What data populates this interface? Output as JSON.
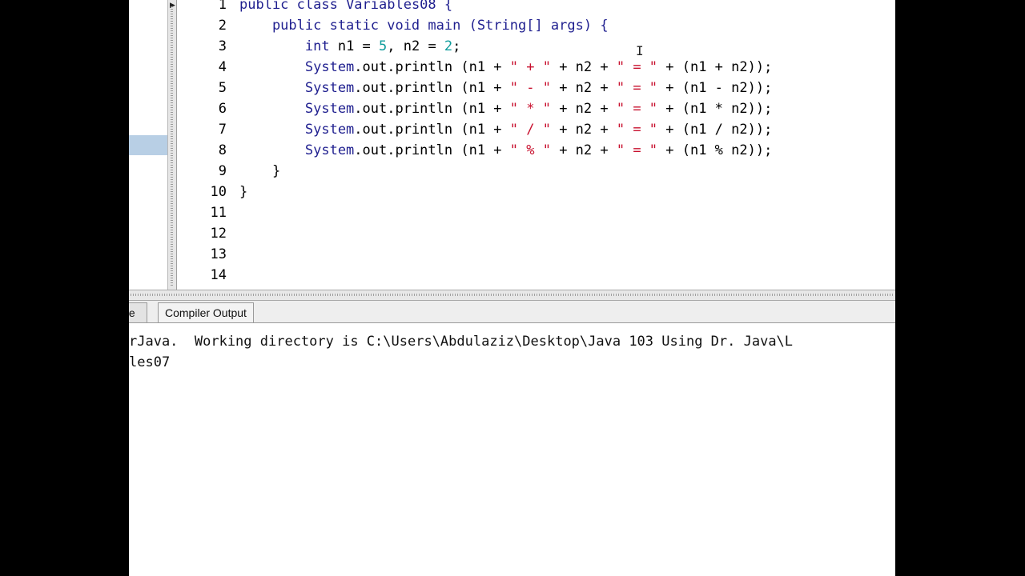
{
  "editor": {
    "lines": [
      {
        "n": "1",
        "segs": [
          {
            "t": "public class ",
            "c": "kw"
          },
          {
            "t": "Variables08",
            "c": "ty"
          },
          {
            "t": " {",
            "c": "kw"
          }
        ]
      },
      {
        "n": "2",
        "segs": [
          {
            "t": "    public static void ",
            "c": "kw"
          },
          {
            "t": "main (String[] args) {",
            "c": "ty"
          }
        ]
      },
      {
        "n": "3",
        "segs": [
          {
            "t": "        int ",
            "c": "kw"
          },
          {
            "t": "n1 = ",
            "c": ""
          },
          {
            "t": "5",
            "c": "num"
          },
          {
            "t": ", n2 = ",
            "c": ""
          },
          {
            "t": "2",
            "c": "num"
          },
          {
            "t": ";",
            "c": ""
          }
        ]
      },
      {
        "n": "4",
        "segs": [
          {
            "t": "        System",
            "c": "kw"
          },
          {
            "t": ".out.println (n1 + ",
            "c": ""
          },
          {
            "t": "\" + \"",
            "c": "str"
          },
          {
            "t": " + n2 + ",
            "c": ""
          },
          {
            "t": "\" = \"",
            "c": "str"
          },
          {
            "t": " + (n1 + n2));",
            "c": ""
          }
        ]
      },
      {
        "n": "5",
        "segs": [
          {
            "t": "        System",
            "c": "kw"
          },
          {
            "t": ".out.println (n1 + ",
            "c": ""
          },
          {
            "t": "\" - \"",
            "c": "str"
          },
          {
            "t": " + n2 + ",
            "c": ""
          },
          {
            "t": "\" = \"",
            "c": "str"
          },
          {
            "t": " + (n1 - n2));",
            "c": ""
          }
        ]
      },
      {
        "n": "6",
        "segs": [
          {
            "t": "        System",
            "c": "kw"
          },
          {
            "t": ".out.println (n1 + ",
            "c": ""
          },
          {
            "t": "\" * \"",
            "c": "str"
          },
          {
            "t": " + n2 + ",
            "c": ""
          },
          {
            "t": "\" = \"",
            "c": "str"
          },
          {
            "t": " + (n1 * n2));",
            "c": ""
          }
        ]
      },
      {
        "n": "7",
        "segs": [
          {
            "t": "        System",
            "c": "kw"
          },
          {
            "t": ".out.println (n1 + ",
            "c": ""
          },
          {
            "t": "\" / \"",
            "c": "str"
          },
          {
            "t": " + n2 + ",
            "c": ""
          },
          {
            "t": "\" = \"",
            "c": "str"
          },
          {
            "t": " + (n1 / n2));",
            "c": ""
          }
        ]
      },
      {
        "n": "8",
        "segs": [
          {
            "t": "        System",
            "c": "kw"
          },
          {
            "t": ".out.println (n1 + ",
            "c": ""
          },
          {
            "t": "\" % \"",
            "c": "str"
          },
          {
            "t": " + n2 + ",
            "c": ""
          },
          {
            "t": "\" = \"",
            "c": "str"
          },
          {
            "t": " + (n1 % n2));",
            "c": ""
          }
        ]
      },
      {
        "n": "9",
        "segs": [
          {
            "t": "    }",
            "c": ""
          }
        ]
      },
      {
        "n": "10",
        "segs": [
          {
            "t": "}",
            "c": ""
          }
        ]
      },
      {
        "n": "11",
        "segs": []
      },
      {
        "n": "12",
        "segs": []
      },
      {
        "n": "13",
        "segs": []
      },
      {
        "n": "14",
        "segs": []
      }
    ]
  },
  "tabs": {
    "console_label": "ole",
    "compiler_label": "Compiler Output"
  },
  "output": {
    "lines": [
      "rJava.  Working directory is C:\\Users\\Abdulaziz\\Desktop\\Java 103 Using Dr. Java\\L",
      "les07"
    ]
  },
  "colors": {
    "keyword": "#1f1f8f",
    "string": "#c8102e",
    "number": "#0f9c9c",
    "selection": "#b8cfe5"
  }
}
